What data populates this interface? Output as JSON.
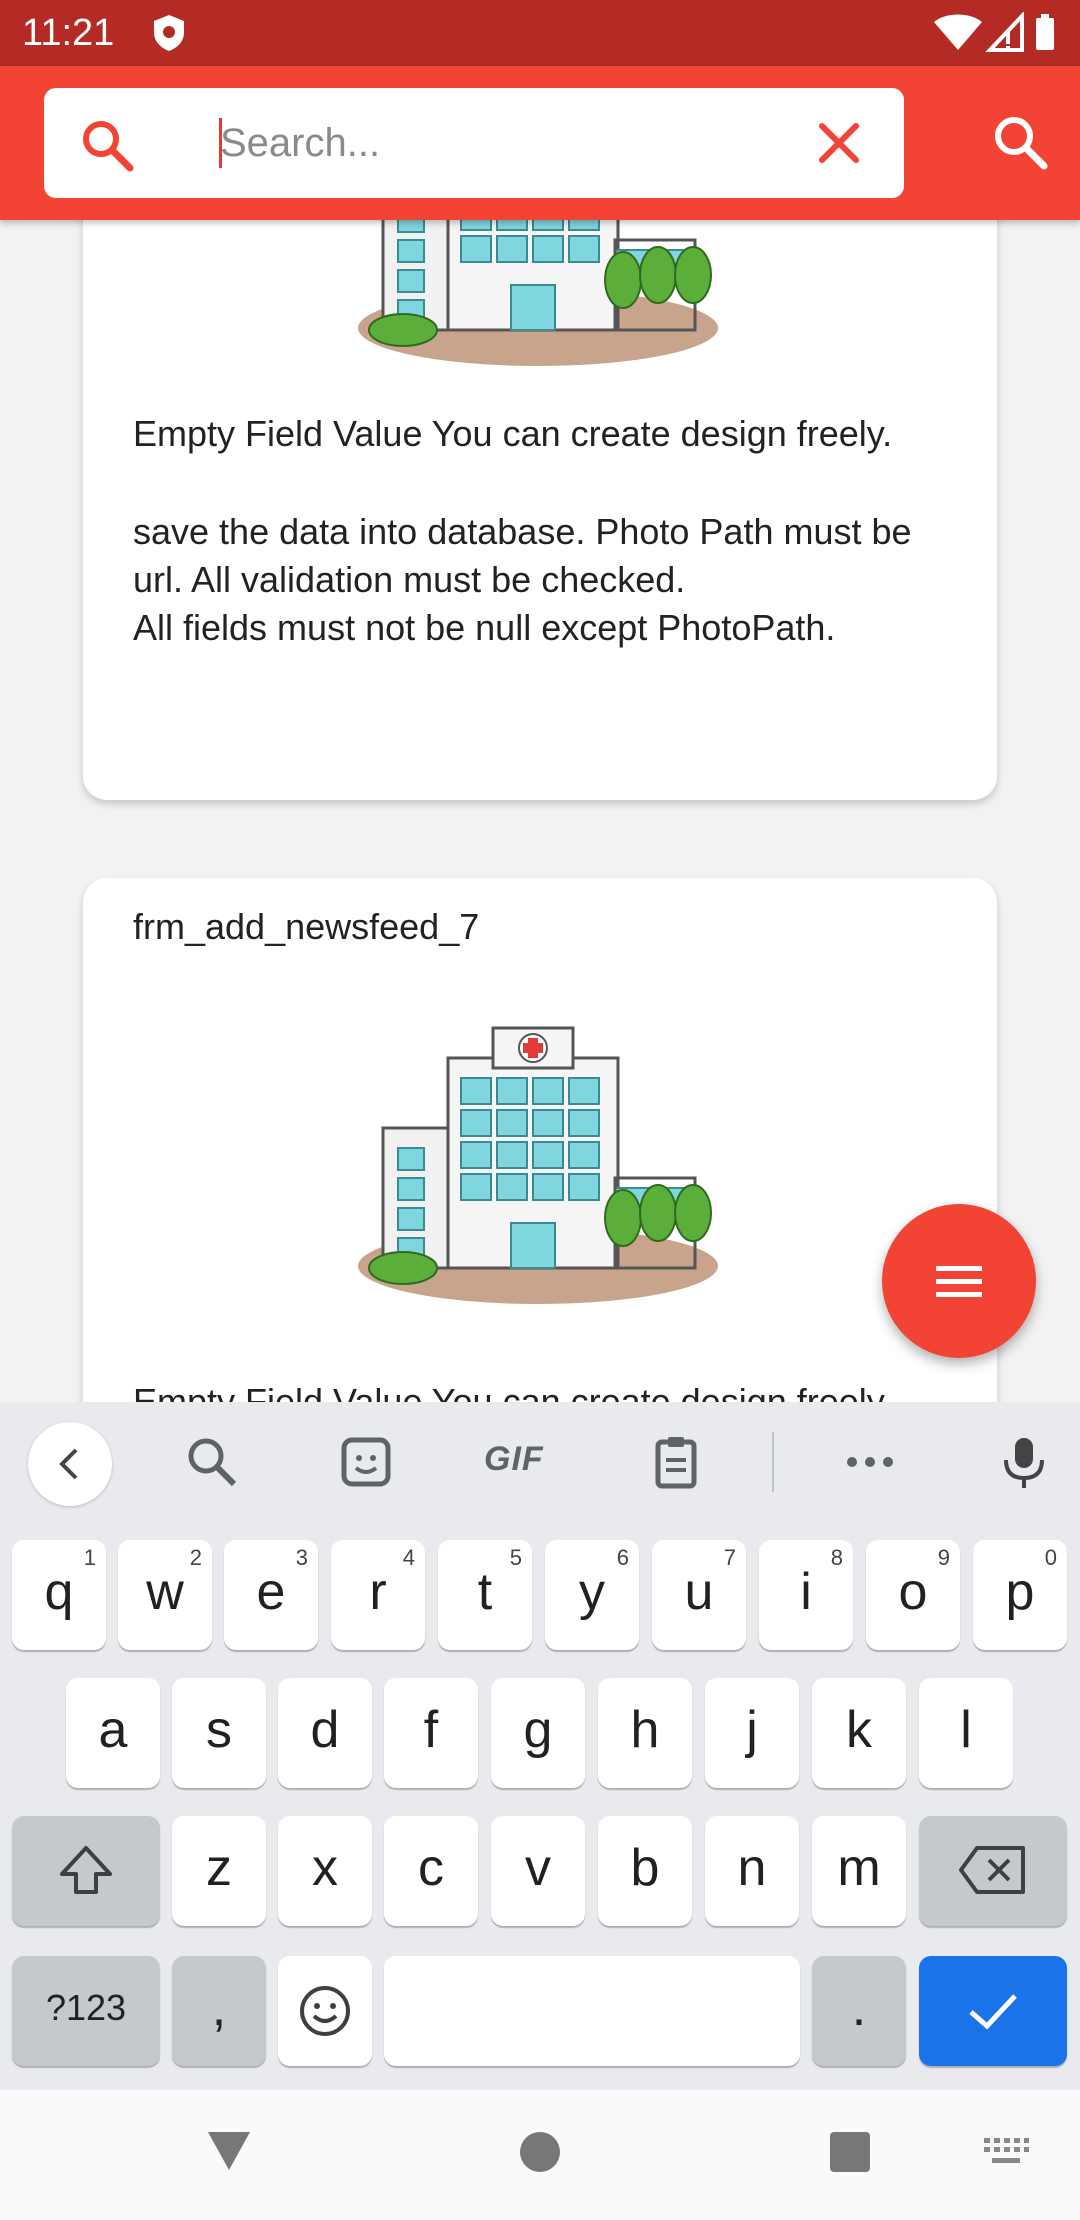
{
  "status_bar": {
    "time": "11:21"
  },
  "app_bar": {
    "search_placeholder": "Search..."
  },
  "cards": [
    {
      "title": "",
      "body_line1": "Empty Field Value You can create design freely.",
      "body_line2": "save the data into database. Photo Path must be url. All validation must be checked.",
      "body_line3": "All fields must not be null except PhotoPath."
    },
    {
      "title": "frm_add_newsfeed_7",
      "body_line1": "Empty Field Value You can create design freely."
    }
  ],
  "keyboard": {
    "toolbar_gif": "GIF",
    "row1": [
      {
        "k": "q",
        "h": "1"
      },
      {
        "k": "w",
        "h": "2"
      },
      {
        "k": "e",
        "h": "3"
      },
      {
        "k": "r",
        "h": "4"
      },
      {
        "k": "t",
        "h": "5"
      },
      {
        "k": "y",
        "h": "6"
      },
      {
        "k": "u",
        "h": "7"
      },
      {
        "k": "i",
        "h": "8"
      },
      {
        "k": "o",
        "h": "9"
      },
      {
        "k": "p",
        "h": "0"
      }
    ],
    "row2": [
      "a",
      "s",
      "d",
      "f",
      "g",
      "h",
      "j",
      "k",
      "l"
    ],
    "row3": [
      "z",
      "x",
      "c",
      "v",
      "b",
      "n",
      "m"
    ],
    "symbols_label": "?123",
    "comma": ",",
    "period": "."
  },
  "colors": {
    "status_bar": "#b42a25",
    "app_bar": "#f34335",
    "fab": "#f34335",
    "enter_key": "#1a73e8"
  }
}
